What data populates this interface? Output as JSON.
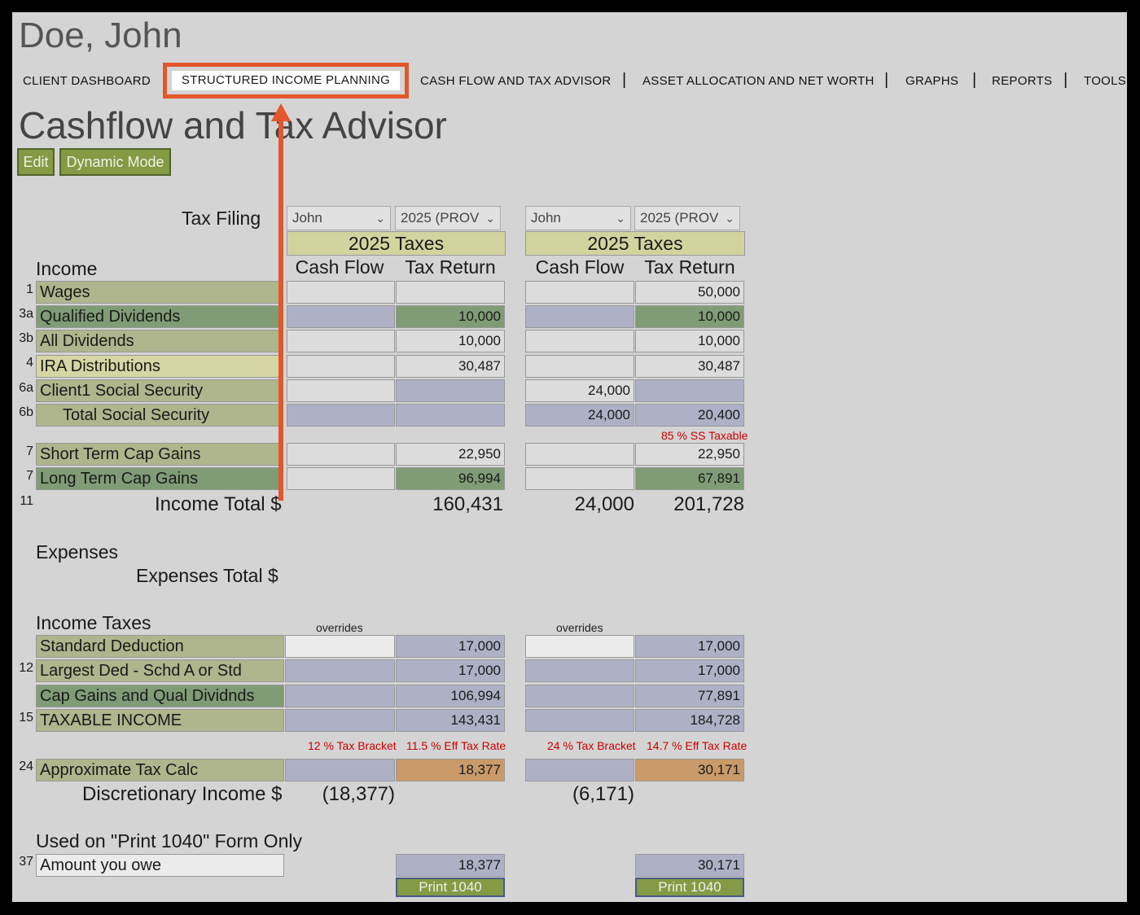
{
  "client": {
    "name": "Doe, John"
  },
  "nav": {
    "items": [
      "CLIENT DASHBOARD",
      "STRUCTURED INCOME PLANNING",
      "CASH FLOW AND TAX ADVISOR",
      "ASSET ALLOCATION AND NET WORTH",
      "GRAPHS",
      "REPORTS",
      "TOOLS"
    ],
    "active_index": 1,
    "highlight_color": "#e3572b"
  },
  "page": {
    "title": "Cashflow and Tax Advisor",
    "edit_label": "Edit",
    "dynamic_label": "Dynamic Mode",
    "tax_filing_label": "Tax Filing",
    "income_label": "Income",
    "expenses_label": "Expenses",
    "expenses_total_label": "Expenses Total $",
    "income_taxes_label": "Income Taxes",
    "income_total_label": "Income Total $",
    "discretionary_label": "Discretionary Income $",
    "print_section_label": "Used on \"Print 1040\" Form Only"
  },
  "columns": [
    {
      "person": "John",
      "year": "2025 (PROV",
      "header": "2025 Taxes",
      "cf_label": "Cash Flow",
      "tr_label": "Tax Return",
      "ss_note": "",
      "income_total_cf": "",
      "income_total_tr": "160,431",
      "overrides_label": "overrides",
      "bracket": "12 % Tax Bracket",
      "eff_rate": "11.5 % Eff Tax Rate",
      "discretionary": "(18,377)",
      "amount_owe": "18,377",
      "print_label": "Print 1040"
    },
    {
      "person": "John",
      "year": "2025 (PROV",
      "header": "2025 Taxes",
      "cf_label": "Cash Flow",
      "tr_label": "Tax Return",
      "ss_note": "85 % SS Taxable",
      "income_total_cf": "24,000",
      "income_total_tr": "201,728",
      "overrides_label": "overrides",
      "bracket": "24 % Tax Bracket",
      "eff_rate": "14.7 % Eff Tax Rate",
      "discretionary": "(6,171)",
      "amount_owe": "30,171",
      "print_label": "Print 1040"
    }
  ],
  "income_rows": [
    {
      "num": "1",
      "label": "Wages",
      "c1cf": "",
      "c1tr": "",
      "c2cf": "",
      "c2tr": "50,000"
    },
    {
      "num": "3a",
      "label": "Qualified Dividends",
      "c1cf": "",
      "c1tr": "10,000",
      "c2cf": "",
      "c2tr": "10,000"
    },
    {
      "num": "3b",
      "label": "All Dividends",
      "c1cf": "",
      "c1tr": "10,000",
      "c2cf": "",
      "c2tr": "10,000"
    },
    {
      "num": "4",
      "label": "IRA Distributions",
      "c1cf": "",
      "c1tr": "30,487",
      "c2cf": "",
      "c2tr": "30,487"
    },
    {
      "num": "6a",
      "label": "Client1 Social Security",
      "c1cf": "",
      "c1tr": "",
      "c2cf": "24,000",
      "c2tr": ""
    },
    {
      "num": "6b",
      "label": "Total Social Security",
      "c1cf": "",
      "c1tr": "",
      "c2cf": "24,000",
      "c2tr": "20,400"
    },
    {
      "num": "7",
      "label": "Short Term Cap Gains",
      "c1cf": "",
      "c1tr": "22,950",
      "c2cf": "",
      "c2tr": "22,950"
    },
    {
      "num": "7",
      "label": "Long Term Cap Gains",
      "c1cf": "",
      "c1tr": "96,994",
      "c2cf": "",
      "c2tr": "67,891"
    }
  ],
  "income_total_num": "11",
  "tax_rows": [
    {
      "num": "",
      "label": "Standard Deduction",
      "c1cf": "",
      "c1tr": "17,000",
      "c2cf": "",
      "c2tr": "17,000"
    },
    {
      "num": "12",
      "label": "Largest Ded - Schd A or Std",
      "c1cf": "",
      "c1tr": "17,000",
      "c2cf": "",
      "c2tr": "17,000"
    },
    {
      "num": "",
      "label": "Cap Gains and Qual Dividnds",
      "c1cf": "",
      "c1tr": "106,994",
      "c2cf": "",
      "c2tr": "77,891"
    },
    {
      "num": "15",
      "label": "TAXABLE INCOME",
      "c1cf": "",
      "c1tr": "143,431",
      "c2cf": "",
      "c2tr": "184,728"
    }
  ],
  "approx_row": {
    "num": "24",
    "label": "Approximate Tax Calc",
    "c1tr": "18,377",
    "c2tr": "30,171"
  },
  "owe_row": {
    "num": "37",
    "label": "Amount you owe"
  }
}
